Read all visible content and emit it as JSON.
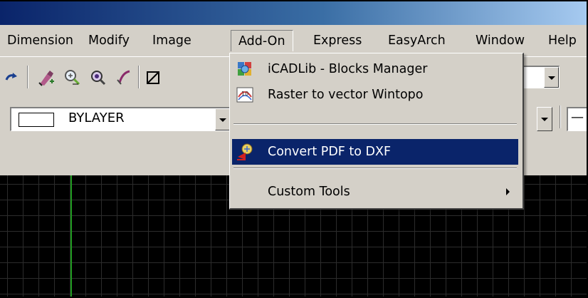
{
  "menubar": {
    "items": [
      {
        "label": "Dimension"
      },
      {
        "label": "Modify"
      },
      {
        "label": "Image"
      },
      {
        "label": "Add-On"
      },
      {
        "label": "Express"
      },
      {
        "label": "EasyArch"
      },
      {
        "label": "Window"
      },
      {
        "label": "Help"
      }
    ],
    "active": "Add-On"
  },
  "toolbar": {
    "icons": [
      "redo-icon",
      "paint-brush-icon",
      "zoom-realtime-icon",
      "zoom-window-icon",
      "pan-icon",
      "snap-icon"
    ]
  },
  "properties": {
    "color_value": "BYLAYER",
    "right_combo_value": "—"
  },
  "addon_menu": {
    "items": [
      {
        "label": "iCADLib - Blocks Manager",
        "icon": "blocks-manager-icon"
      },
      {
        "label": "Raster to vector Wintopo",
        "icon": "raster-vector-icon"
      },
      {
        "label": "Convert PDF to DXF",
        "icon": "pdf-to-dxf-icon",
        "selected": true
      },
      {
        "label": "Custom Tools",
        "has_submenu": true
      }
    ]
  },
  "colors": {
    "menu_highlight": "#0a246a",
    "face": "#d4d0c8",
    "canvas": "#000000",
    "axis_green": "#1f9a1f"
  }
}
